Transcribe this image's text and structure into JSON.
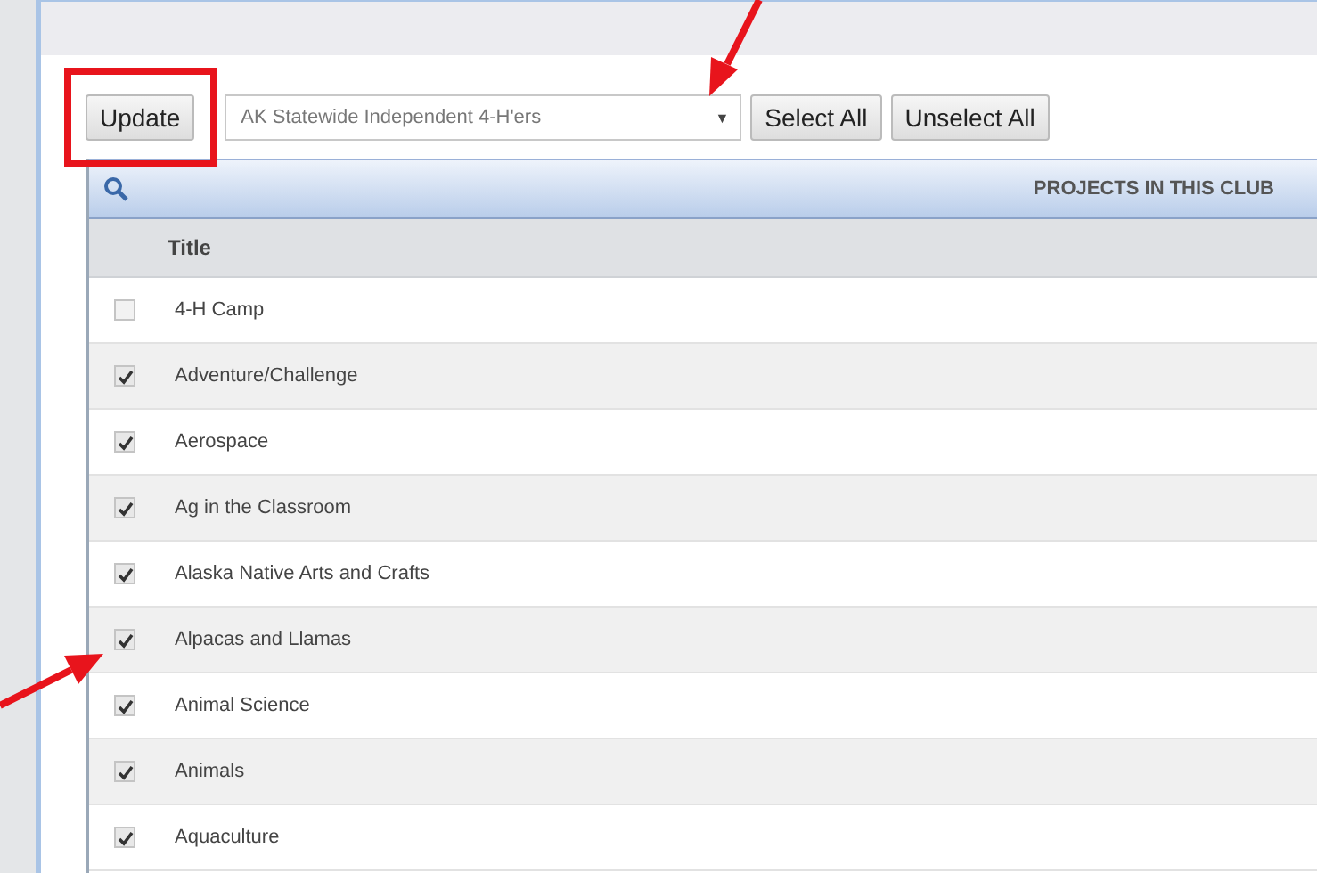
{
  "toolbar": {
    "update_button": "Update",
    "club_select": {
      "value": "AK Statewide Independent 4-H'ers",
      "arrow": "▼"
    },
    "buttons": [
      "Select All",
      "Unselect All"
    ]
  },
  "grid": {
    "header_title": "PROJECTS IN THIS CLUB",
    "columns": [
      "Title"
    ],
    "rows": [
      {
        "title": "4-H Camp",
        "checked": false
      },
      {
        "title": "Adventure/Challenge",
        "checked": true
      },
      {
        "title": "Aerospace",
        "checked": true
      },
      {
        "title": "Ag in the Classroom",
        "checked": true
      },
      {
        "title": "Alaska Native Arts and Crafts",
        "checked": true
      },
      {
        "title": "Alpacas and Llamas",
        "checked": true
      },
      {
        "title": "Animal Science",
        "checked": true
      },
      {
        "title": "Animals",
        "checked": true
      },
      {
        "title": "Aquaculture",
        "checked": true
      }
    ]
  }
}
